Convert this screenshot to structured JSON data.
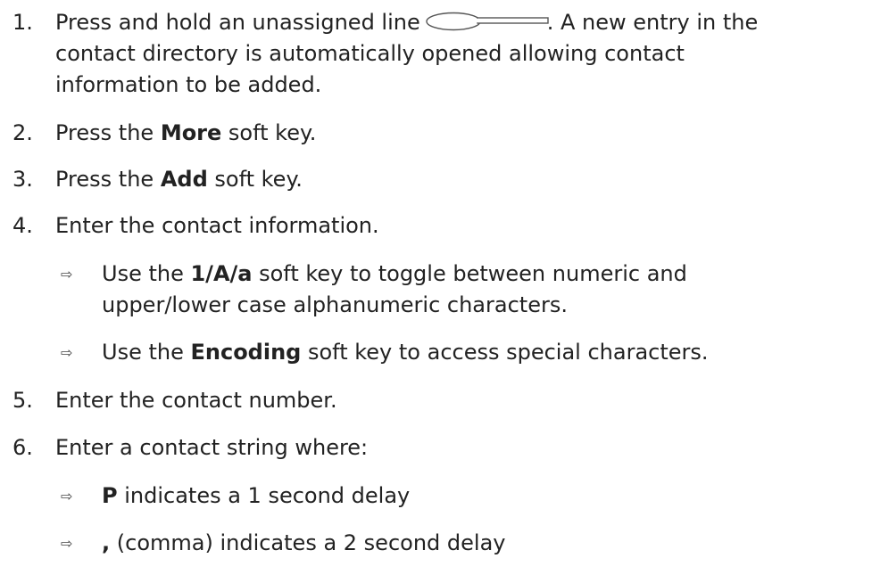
{
  "steps": [
    {
      "number": "1.",
      "line1_before": "Press and hold an unassigned line",
      "line1_after": ". A new entry in the",
      "line2": "contact directory is automatically opened allowing contact",
      "line3": "information to be added."
    },
    {
      "number": "2.",
      "before": "Press the ",
      "bold": "More",
      "after": " soft key."
    },
    {
      "number": "3.",
      "before": "Press the ",
      "bold": "Add",
      "after": " soft key."
    },
    {
      "number": "4.",
      "text": "Enter the contact information.",
      "subitems": [
        {
          "before": "Use the ",
          "bold": "1/A/a",
          "after": " soft key to toggle between numeric and",
          "line2": "upper/lower case alphanumeric characters."
        },
        {
          "before": "Use the ",
          "bold": "Encoding",
          "after": " soft key to access special characters."
        }
      ]
    },
    {
      "number": "5.",
      "text": "Enter the contact number."
    },
    {
      "number": "6.",
      "text": "Enter a contact string where:",
      "subitems": [
        {
          "bold": "P",
          "after": " indicates a 1 second delay"
        },
        {
          "bold": ",",
          "after": " (comma) indicates a 2 second delay"
        }
      ]
    }
  ],
  "bullet_glyph": "⇨",
  "icons": {
    "line_key": "line-key-icon"
  }
}
